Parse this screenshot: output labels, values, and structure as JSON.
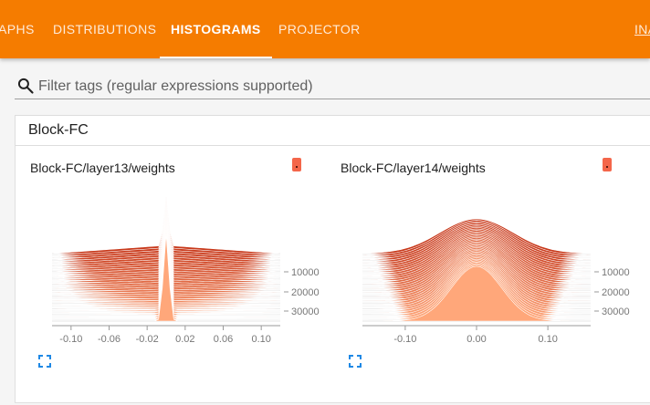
{
  "nav": {
    "tabs": [
      {
        "label": "APHS",
        "active": false
      },
      {
        "label": "DISTRIBUTIONS",
        "active": false
      },
      {
        "label": "HISTOGRAMS",
        "active": true
      },
      {
        "label": "PROJECTOR",
        "active": false
      }
    ],
    "right_label": "INA",
    "bar_color": "#f57c00"
  },
  "search": {
    "icon": "search-icon",
    "placeholder": "Filter tags (regular expressions supported)",
    "value": ""
  },
  "section": {
    "title": "Block-FC"
  },
  "cards": [
    {
      "title": "Block-FC/layer13/weights",
      "info_icon": "info-icon",
      "expand_icon": "fullscreen-icon",
      "x_tick_labels": [
        "-0.10",
        "-0.06",
        "-0.02",
        "0.02",
        "0.06",
        "0.10"
      ],
      "y_tick_labels": [
        "10000",
        "20000",
        "30000"
      ]
    },
    {
      "title": "Block-FC/layer14/weights",
      "info_icon": "info-icon",
      "expand_icon": "fullscreen-icon",
      "x_tick_labels": [
        "-0.10",
        "0.00",
        "0.10"
      ],
      "y_tick_labels": [
        "10000",
        "20000",
        "30000"
      ]
    }
  ],
  "colors": {
    "accent": "#f57c00",
    "histogram_back": "#c8391b",
    "histogram_front": "#ffa77a",
    "info_button": "#f4664a",
    "expand_icon": "#1e88e5"
  },
  "chart_data": [
    {
      "type": "area",
      "title": "Block-FC/layer13/weights",
      "description_type": "stacked histogram (ridge) over steps",
      "x_ticks": [
        -0.1,
        -0.06,
        -0.02,
        0.02,
        0.06,
        0.1
      ],
      "xlim": [
        -0.12,
        0.12
      ],
      "step_ticks": [
        10000,
        20000,
        30000
      ],
      "distribution_center": 0.0,
      "shape": "very narrow peak near 0 with wide flat tails in early steps"
    },
    {
      "type": "area",
      "title": "Block-FC/layer14/weights",
      "description_type": "stacked histogram (ridge) over steps",
      "x_ticks": [
        -0.1,
        0.0,
        0.1
      ],
      "xlim": [
        -0.16,
        0.16
      ],
      "step_ticks": [
        10000,
        20000,
        30000
      ],
      "distribution_center": 0.0,
      "shape": "broad bell shape centered at 0"
    }
  ]
}
